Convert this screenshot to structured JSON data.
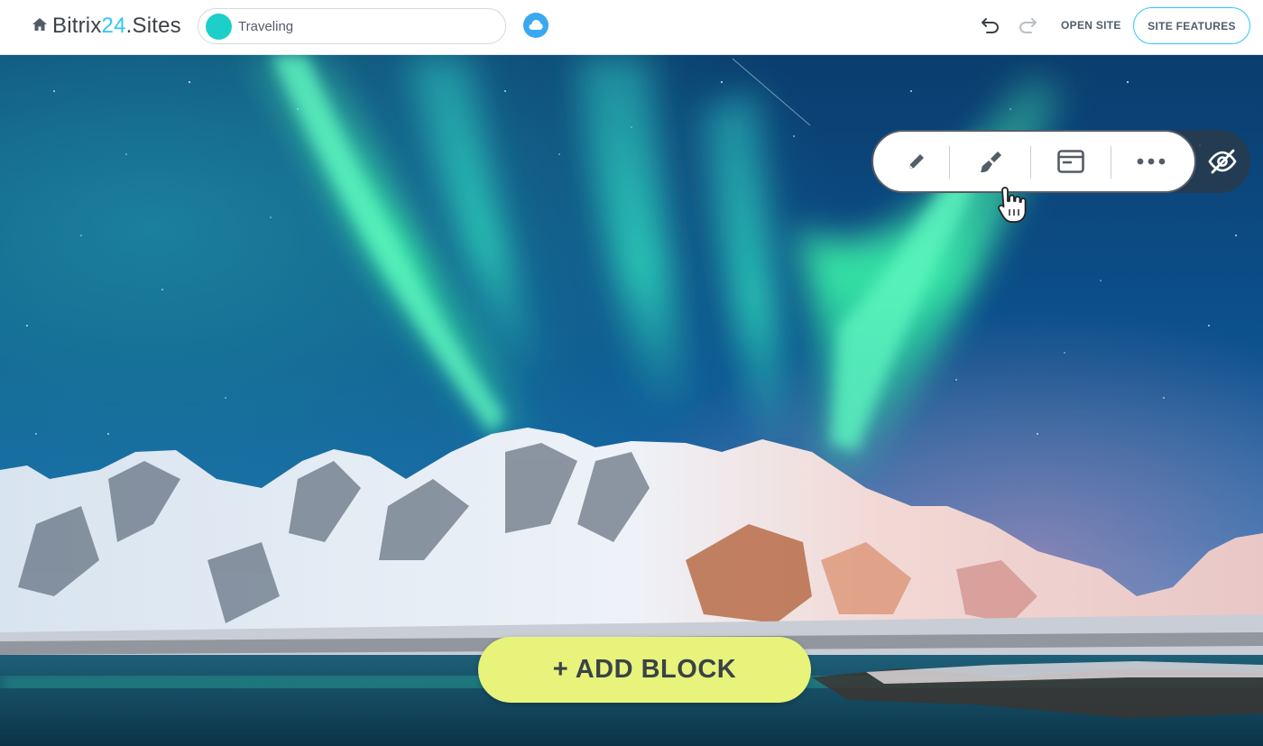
{
  "header": {
    "brand_name": "Bitrix",
    "brand_number": "24",
    "brand_suffix": ".Sites",
    "home_icon": "home-icon",
    "site_selector": {
      "name": "Traveling",
      "dot_color": "#1ccfc9"
    },
    "publish_icon": "cloud-icon",
    "undo_icon": "undo-icon",
    "redo_icon": "redo-icon",
    "open_site_label": "OPEN SITE",
    "site_features_label": "SITE FEATURES"
  },
  "hero": {
    "image": "northern-lights-over-snowy-mountains",
    "block_toolbar": {
      "buttons": [
        {
          "icon": "pencil-icon",
          "action": "edit"
        },
        {
          "icon": "brush-icon",
          "action": "design"
        },
        {
          "icon": "window-icon",
          "action": "block-settings"
        },
        {
          "icon": "more-icon",
          "action": "more"
        }
      ],
      "hide_icon": "eye-off-icon"
    },
    "add_block_label": "+ ADD BLOCK"
  },
  "colors": {
    "accent": "#2fc6f6",
    "add_block_bg": "#e7f37a",
    "text": "#525c69",
    "aurora": "#3af5b0",
    "sky": "#0b4c8a"
  }
}
